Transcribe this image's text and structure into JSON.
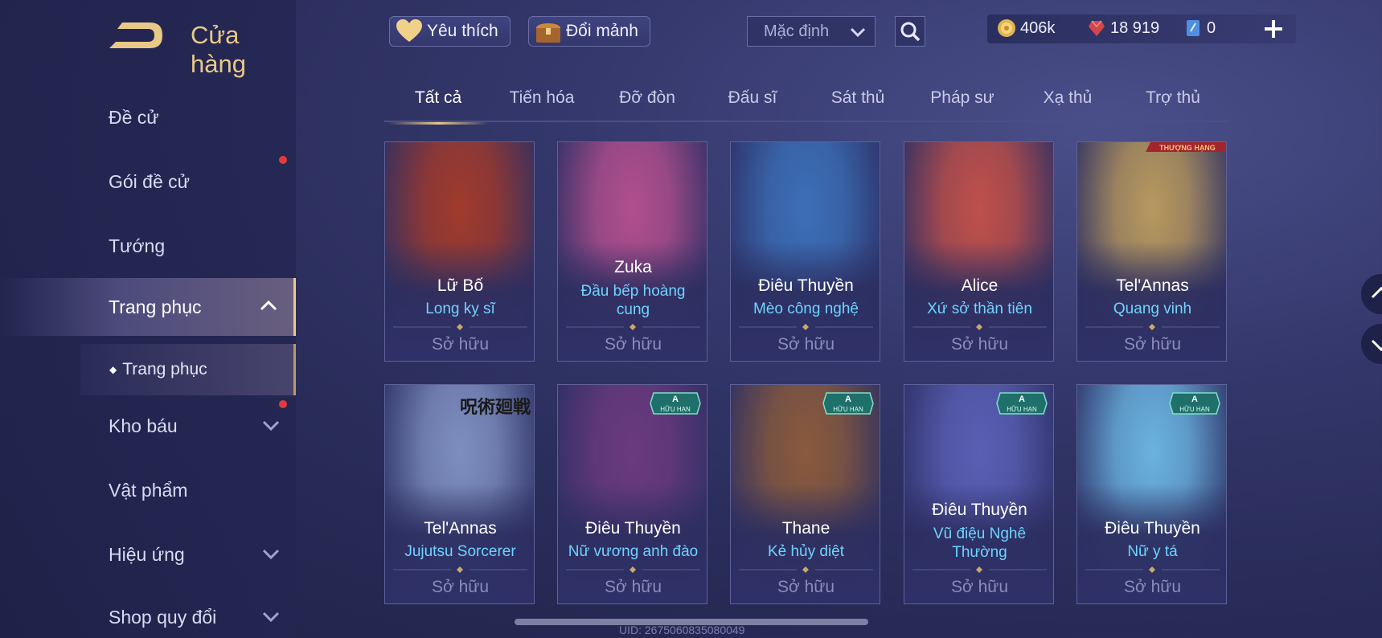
{
  "header": {
    "title": "Cửa hàng",
    "favorites_label": "Yêu thích",
    "exchange_label": "Đổi mảnh",
    "sort_value": "Mặc định"
  },
  "currency": {
    "gold": "406k",
    "vouchers": "18 919",
    "tokens": "0"
  },
  "sidebar": {
    "items": [
      {
        "label": "Đề cử"
      },
      {
        "label": "Gói đề cử"
      },
      {
        "label": "Tướng"
      },
      {
        "label": "Trang phục"
      },
      {
        "label": "Trang phục"
      },
      {
        "label": "Kho báu"
      },
      {
        "label": "Vật phẩm"
      },
      {
        "label": "Hiệu ứng"
      },
      {
        "label": "Shop quy đổi"
      }
    ]
  },
  "tabs": [
    "Tất cả",
    "Tiến hóa",
    "Đỡ đòn",
    "Đấu sĩ",
    "Sát thủ",
    "Pháp sư",
    "Xạ thủ",
    "Trợ thủ"
  ],
  "cards": [
    {
      "hero": "Lữ Bố",
      "skin": "Long kỵ sĩ",
      "status": "Sở hữu",
      "art": "#a13a2c"
    },
    {
      "hero": "Zuka",
      "skin": "Đầu bếp hoàng cung",
      "status": "Sở hữu",
      "art": "#b24f8e"
    },
    {
      "hero": "Điêu Thuyền",
      "skin": "Mèo công nghệ",
      "status": "Sở hữu",
      "art": "#3c6fb8"
    },
    {
      "hero": "Alice",
      "skin": "Xứ sở thần tiên",
      "status": "Sở hữu",
      "art": "#c0504a"
    },
    {
      "hero": "Tel'Annas",
      "skin": "Quang vinh",
      "status": "Sở hữu",
      "art": "#b7985e",
      "ribbon": "THƯỢNG HẠNG"
    },
    {
      "hero": "Tel'Annas",
      "skin": "Jujutsu Sorcerer",
      "status": "Sở hữu",
      "art": "#7e8fbf",
      "watermark": "呪術廻戦"
    },
    {
      "hero": "Điêu Thuyền",
      "skin": "Nữ vương anh đào",
      "status": "Sở hữu",
      "art": "#6b3a7e",
      "badge_grade": "A",
      "badge_text": "HỮU HẠN"
    },
    {
      "hero": "Thane",
      "skin": "Kẻ hủy diệt",
      "status": "Sở hữu",
      "art": "#8a5a3c",
      "badge_grade": "A",
      "badge_text": "HỮU HẠN"
    },
    {
      "hero": "Điêu Thuyền",
      "skin": "Vũ điệu Nghê Thường",
      "status": "Sở hữu",
      "art": "#5a5fb5",
      "badge_grade": "A",
      "badge_text": "HỮU HẠN"
    },
    {
      "hero": "Điêu Thuyền",
      "skin": "Nữ y tá",
      "status": "Sở hữu",
      "art": "#6ab3e0",
      "badge_grade": "A",
      "badge_text": "HỮU HẠN"
    }
  ],
  "footer": {
    "uid": "UID: 2675060835080049"
  }
}
